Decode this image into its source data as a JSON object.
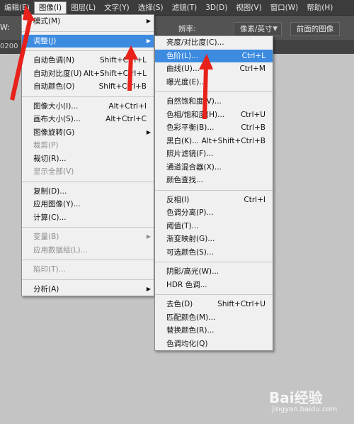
{
  "menubar": {
    "items": [
      {
        "label": "编辑(E)",
        "active": false
      },
      {
        "label": "图像(I)",
        "active": true
      },
      {
        "label": "图层(L)",
        "active": false
      },
      {
        "label": "文字(Y)",
        "active": false
      },
      {
        "label": "选择(S)",
        "active": false
      },
      {
        "label": "滤镜(T)",
        "active": false
      },
      {
        "label": "3D(D)",
        "active": false
      },
      {
        "label": "视图(V)",
        "active": false
      },
      {
        "label": "窗口(W)",
        "active": false
      },
      {
        "label": "帮助(H)",
        "active": false
      }
    ]
  },
  "optbar": {
    "w_label": "W:",
    "resolution_label": "辨率:",
    "unit_value": "像素/英寸",
    "front_image_button": "前面的图像"
  },
  "doc_tab": "0200",
  "main_menu": {
    "items": [
      {
        "label": "模式(M)",
        "shortcut": "",
        "submenu": true,
        "disabled": false,
        "sep_after": true
      },
      {
        "label": "调整(J)",
        "shortcut": "",
        "submenu": true,
        "disabled": false,
        "highlight": true,
        "sep_after": true
      },
      {
        "label": "自动色调(N)",
        "shortcut": "Shift+Ctrl+L",
        "submenu": false,
        "disabled": false
      },
      {
        "label": "自动对比度(U)",
        "shortcut": "Alt+Shift+Ctrl+L",
        "submenu": false,
        "disabled": false
      },
      {
        "label": "自动颜色(O)",
        "shortcut": "Shift+Ctrl+B",
        "submenu": false,
        "disabled": false,
        "sep_after": true
      },
      {
        "label": "图像大小(I)...",
        "shortcut": "Alt+Ctrl+I",
        "submenu": false,
        "disabled": false
      },
      {
        "label": "画布大小(S)...",
        "shortcut": "Alt+Ctrl+C",
        "submenu": false,
        "disabled": false
      },
      {
        "label": "图像旋转(G)",
        "shortcut": "",
        "submenu": true,
        "disabled": false
      },
      {
        "label": "裁剪(P)",
        "shortcut": "",
        "submenu": false,
        "disabled": true
      },
      {
        "label": "裁切(R)...",
        "shortcut": "",
        "submenu": false,
        "disabled": false
      },
      {
        "label": "显示全部(V)",
        "shortcut": "",
        "submenu": false,
        "disabled": true,
        "sep_after": true
      },
      {
        "label": "复制(D)...",
        "shortcut": "",
        "submenu": false,
        "disabled": false
      },
      {
        "label": "应用图像(Y)...",
        "shortcut": "",
        "submenu": false,
        "disabled": false
      },
      {
        "label": "计算(C)...",
        "shortcut": "",
        "submenu": false,
        "disabled": false,
        "sep_after": true
      },
      {
        "label": "变量(B)",
        "shortcut": "",
        "submenu": true,
        "disabled": true
      },
      {
        "label": "应用数据组(L)...",
        "shortcut": "",
        "submenu": false,
        "disabled": true,
        "sep_after": true
      },
      {
        "label": "陷印(T)...",
        "shortcut": "",
        "submenu": false,
        "disabled": true,
        "sep_after": true
      },
      {
        "label": "分析(A)",
        "shortcut": "",
        "submenu": true,
        "disabled": false
      }
    ]
  },
  "sub_menu": {
    "items": [
      {
        "label": "亮度/对比度(C)...",
        "shortcut": "",
        "disabled": false
      },
      {
        "label": "色阶(L)...",
        "shortcut": "Ctrl+L",
        "disabled": false,
        "highlight": true
      },
      {
        "label": "曲线(U)...",
        "shortcut": "Ctrl+M",
        "disabled": false
      },
      {
        "label": "曝光度(E)...",
        "shortcut": "",
        "disabled": false,
        "sep_after": true
      },
      {
        "label": "自然饱和度(V)...",
        "shortcut": "",
        "disabled": false
      },
      {
        "label": "色相/饱和度(H)...",
        "shortcut": "Ctrl+U",
        "disabled": false
      },
      {
        "label": "色彩平衡(B)...",
        "shortcut": "Ctrl+B",
        "disabled": false
      },
      {
        "label": "黑白(K)...",
        "shortcut": "Alt+Shift+Ctrl+B",
        "disabled": false
      },
      {
        "label": "照片滤镜(F)...",
        "shortcut": "",
        "disabled": false
      },
      {
        "label": "通道混合器(X)...",
        "shortcut": "",
        "disabled": false
      },
      {
        "label": "颜色查找...",
        "shortcut": "",
        "disabled": false,
        "sep_after": true
      },
      {
        "label": "反相(I)",
        "shortcut": "Ctrl+I",
        "disabled": false
      },
      {
        "label": "色调分离(P)...",
        "shortcut": "",
        "disabled": false
      },
      {
        "label": "阈值(T)...",
        "shortcut": "",
        "disabled": false
      },
      {
        "label": "渐变映射(G)...",
        "shortcut": "",
        "disabled": false
      },
      {
        "label": "可选颜色(S)...",
        "shortcut": "",
        "disabled": false,
        "sep_after": true
      },
      {
        "label": "阴影/高光(W)...",
        "shortcut": "",
        "disabled": false
      },
      {
        "label": "HDR 色调...",
        "shortcut": "",
        "disabled": false,
        "sep_after": true
      },
      {
        "label": "去色(D)",
        "shortcut": "Shift+Ctrl+U",
        "disabled": false
      },
      {
        "label": "匹配颜色(M)...",
        "shortcut": "",
        "disabled": false
      },
      {
        "label": "替换颜色(R)...",
        "shortcut": "",
        "disabled": false
      },
      {
        "label": "色调均化(Q)",
        "shortcut": "",
        "disabled": false
      }
    ]
  },
  "watermark": {
    "logo": "Bai经验",
    "site": "jingyan.baidu.com"
  },
  "colors": {
    "highlight": "#3c8be0",
    "arrow": "#e8211a",
    "menubar_bg": "#3c3c3c",
    "menu_bg": "#f0f0f0"
  }
}
